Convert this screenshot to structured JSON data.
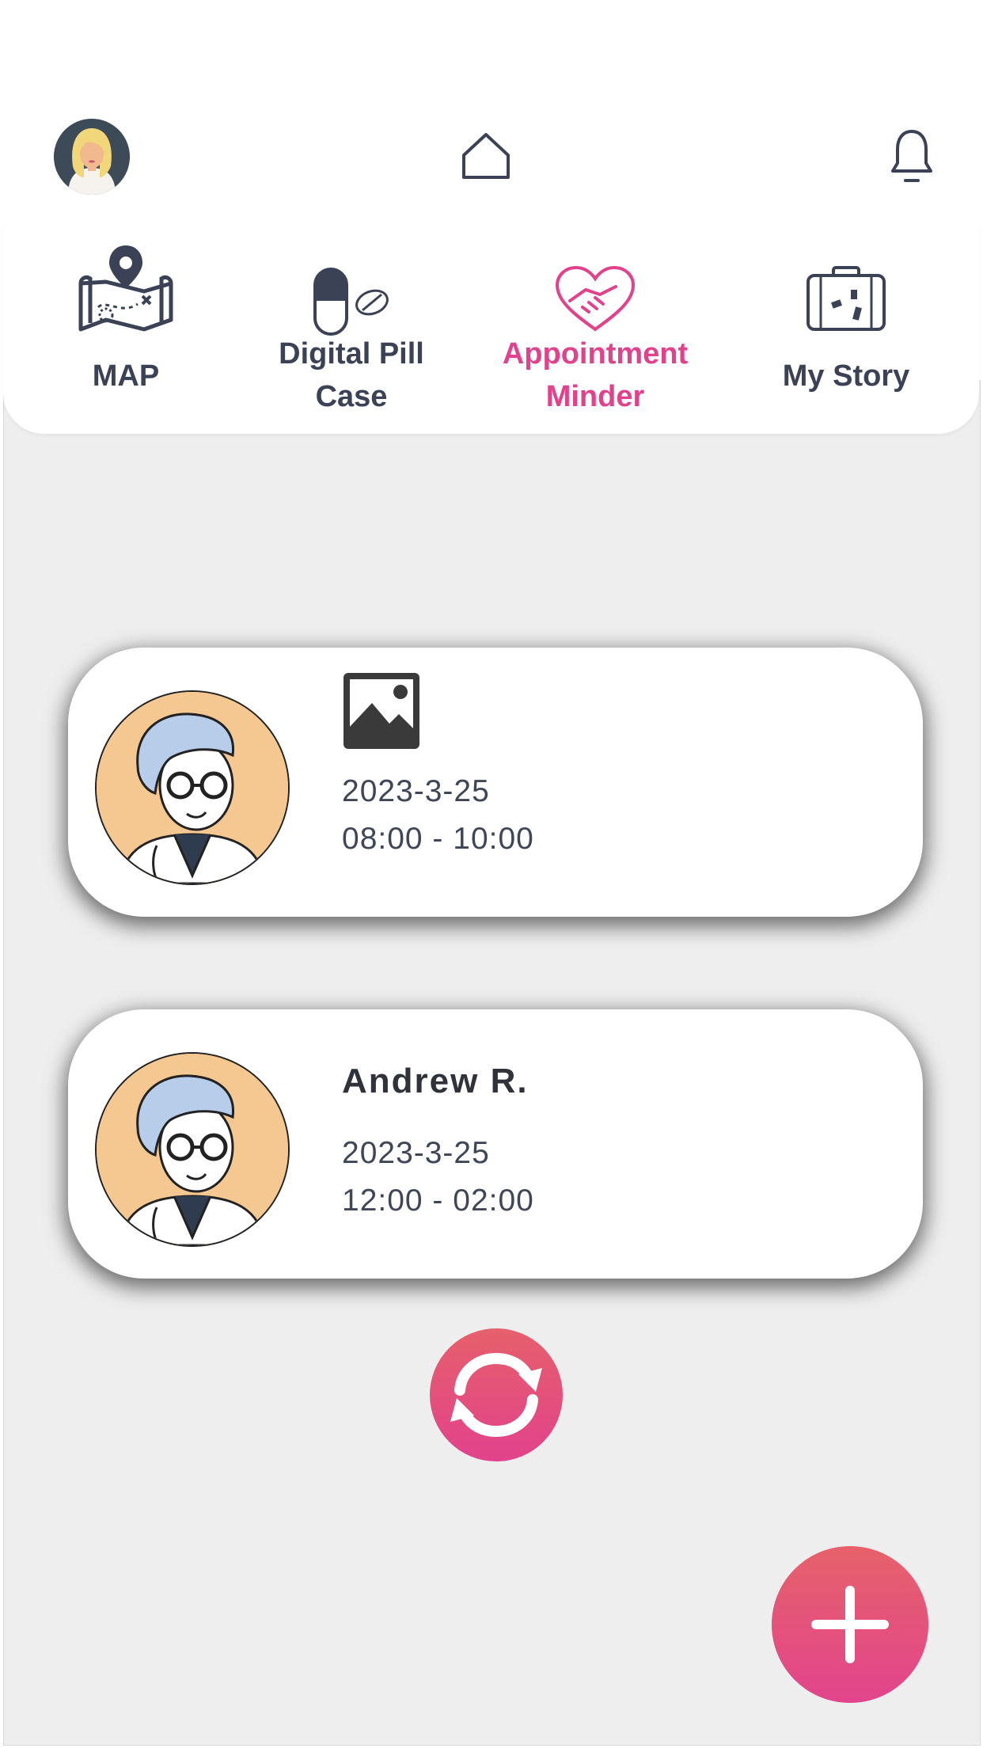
{
  "header": {
    "avatar_icon": "user-avatar",
    "home_icon": "home-icon",
    "bell_icon": "bell-icon"
  },
  "nav": {
    "tabs": [
      {
        "label": "MAP",
        "icon": "map-pin-icon",
        "active": false
      },
      {
        "label": "Digital Pill\nCase",
        "icon": "pill-icon",
        "active": false
      },
      {
        "label": "Appointment\nMinder",
        "icon": "heart-handshake-icon",
        "active": true
      },
      {
        "label": "My Story",
        "icon": "suitcase-icon",
        "active": false
      }
    ],
    "active_color": "#e2428c",
    "inactive_color": "#3b4256"
  },
  "appointments": [
    {
      "name": "",
      "image_placeholder": true,
      "date": "2023-3-25",
      "time": "08:00 - 10:00"
    },
    {
      "name": "Andrew R.",
      "image_placeholder": false,
      "date": "2023-3-25",
      "time": "12:00 - 02:00"
    }
  ],
  "actions": {
    "refresh_icon": "refresh-icon",
    "add_icon": "plus-icon",
    "accent_gradient": [
      "#e6606b",
      "#e2428c"
    ]
  }
}
